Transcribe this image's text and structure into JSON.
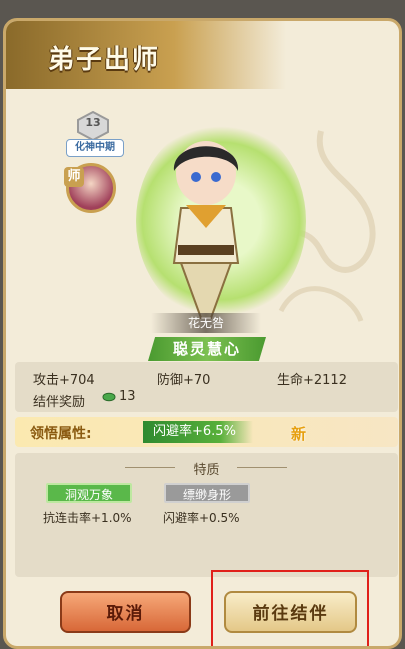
{
  "dialog": {
    "title": "弟子出师"
  },
  "disciple": {
    "realm_level": "13",
    "realm_name": "化神中期",
    "master_tag": "师",
    "name": "花无咎",
    "trait": "聪灵慧心"
  },
  "stats": {
    "attack": "攻击+704",
    "defense": "防御+70",
    "life": "生命+2112",
    "partner_reward_label": "结伴奖励",
    "partner_reward_value": "13"
  },
  "comprehension": {
    "label": "领悟属性:",
    "value": "闪避率+6.5%",
    "new_badge": "新"
  },
  "specialties": {
    "title": "特质",
    "items": [
      {
        "name": "洞观万象",
        "desc": "抗连击率+1.0%"
      },
      {
        "name": "缥缈身形",
        "desc": "闪避率+0.5%"
      }
    ]
  },
  "buttons": {
    "cancel": "取消",
    "partner": "前往结伴"
  },
  "colors": {
    "accent": "#e0201a",
    "trait_green": "#5ab84a"
  }
}
